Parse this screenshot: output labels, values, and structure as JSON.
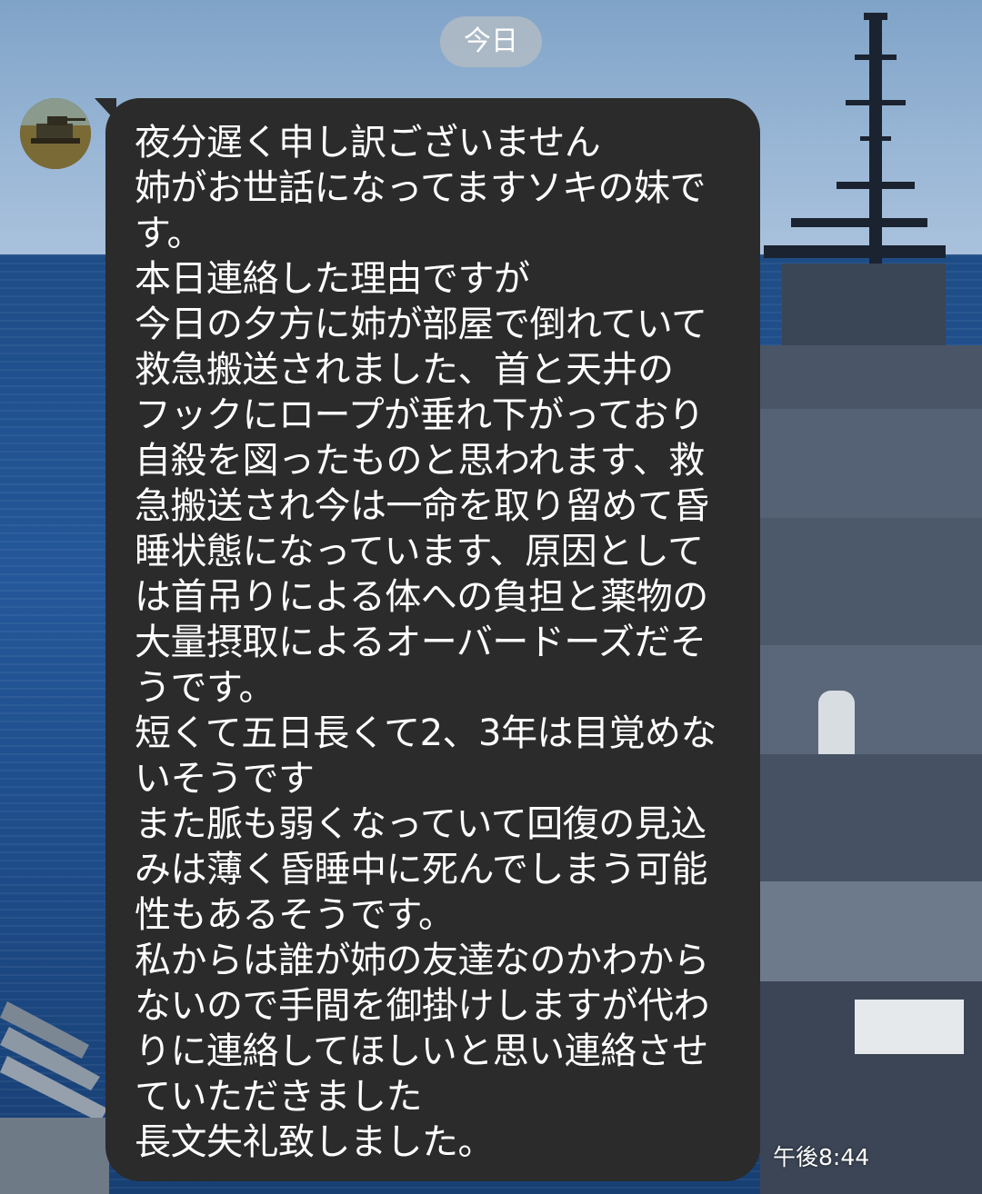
{
  "chat": {
    "date_divider": "今日",
    "messages": [
      {
        "lines": [
          "夜分遅く申し訳ございません",
          "姉がお世話になってますソキの妹で",
          "す。",
          "本日連絡した理由ですが",
          "今日の夕方に姉が部屋で倒れていて",
          "救急搬送されました、首と天井の",
          "フックにロープが垂れ下がっており",
          "自殺を図ったものと思われます、救",
          "急搬送され今は一命を取り留めて昏",
          "睡状態になっています、原因として",
          "は首吊りによる体への負担と薬物の",
          "大量摂取によるオーバードーズだそ",
          "うです。",
          "短くて五日長くて2、3年は目覚めな",
          "いそうです",
          "また脈も弱くなっていて回復の見込",
          "みは薄く昏睡中に死んでしまう可能",
          "性もあるそうです。",
          "私からは誰が姉の友達なのかわから",
          "ないので手間を御掛けしますが代わ",
          "りに連絡してほしいと思い連絡させ",
          "ていただきました",
          "長文失礼致しました。"
        ],
        "time": "午後8:44"
      }
    ]
  },
  "colors": {
    "bubble_background": "#2b2b2b",
    "bubble_text": "#ffffff",
    "date_pill_background": "#afb9c4",
    "sea": "#24579a",
    "sky": "#9ab7d6"
  },
  "icons": {
    "avatar": "sender-avatar-photo"
  }
}
